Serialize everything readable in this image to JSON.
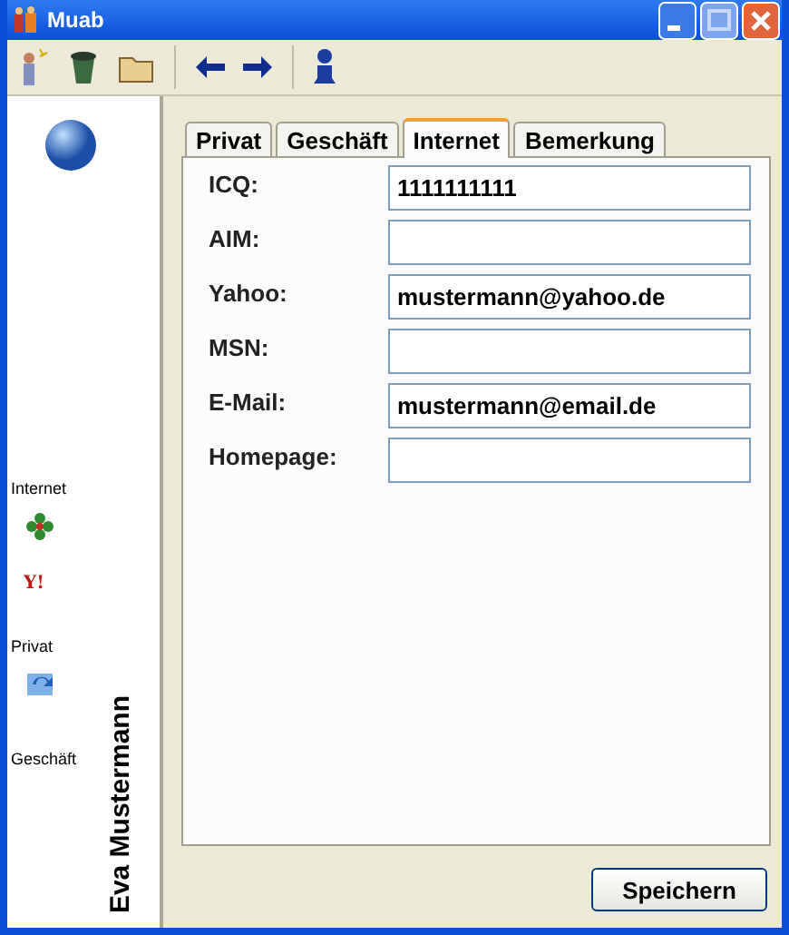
{
  "window": {
    "title": "Muab"
  },
  "sidebar": {
    "groups": [
      {
        "label": "Internet"
      },
      {
        "label": "Privat"
      },
      {
        "label": "Geschäft"
      }
    ],
    "yahoo_logo": "Y!",
    "contact_name": "Eva Mustermann"
  },
  "tabs": [
    {
      "label": "Privat",
      "selected": false
    },
    {
      "label": "Geschäft",
      "selected": false
    },
    {
      "label": "Internet",
      "selected": true
    },
    {
      "label": "Bemerkung",
      "selected": false
    }
  ],
  "fields": [
    {
      "label": "ICQ:",
      "value": "1111111111"
    },
    {
      "label": "AIM:"
    },
    {
      "label": "Yahoo:",
      "value": "mustermann@yahoo.de"
    },
    {
      "label": "MSN:"
    },
    {
      "label": "E-Mail:",
      "value": "mustermann@email.de"
    },
    {
      "label": "Homepage:"
    }
  ],
  "buttons": [
    {
      "label": "Speichern"
    }
  ]
}
